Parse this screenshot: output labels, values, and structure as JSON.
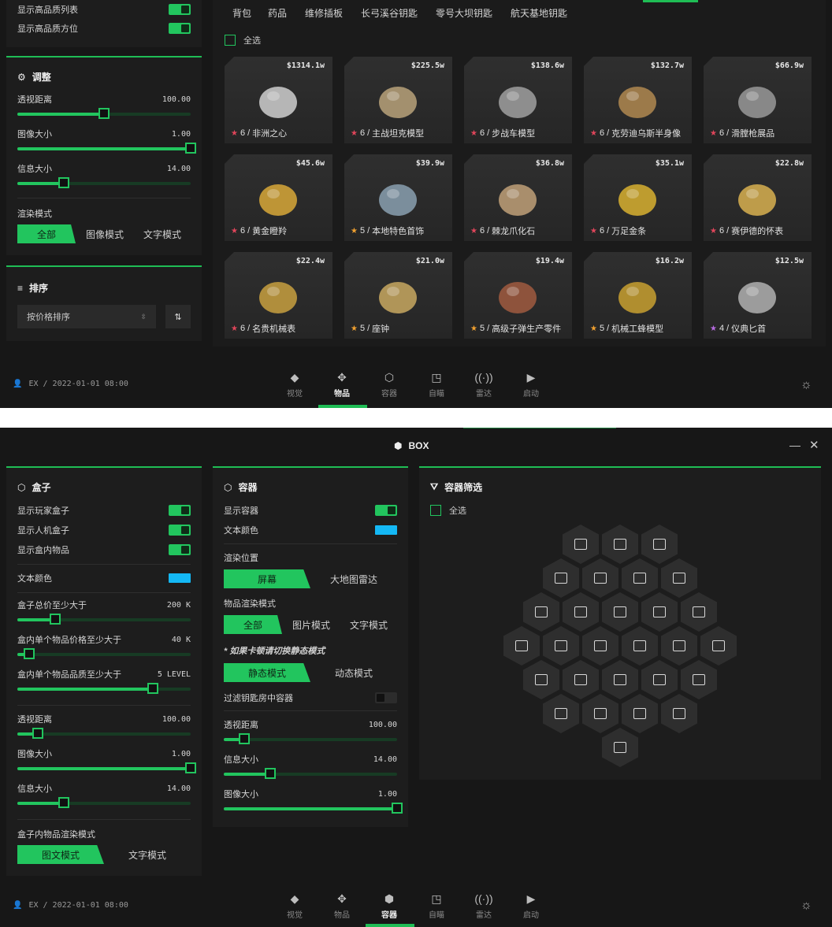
{
  "win1": {
    "top_toggles": [
      {
        "label": "显示高品质列表",
        "on": true
      },
      {
        "label": "显示高品质方位",
        "on": true
      }
    ],
    "adjust": {
      "title": "调整",
      "sliders": [
        {
          "label": "透视距离",
          "value": "100.00",
          "fraction": 0.5
        },
        {
          "label": "图像大小",
          "value": "1.00",
          "fraction": 1.0
        },
        {
          "label": "信息大小",
          "value": "14.00",
          "fraction": 0.27
        }
      ],
      "render_mode_label": "渲染模式",
      "render_modes": [
        "全部",
        "图像模式",
        "文字模式"
      ]
    },
    "sort": {
      "title": "排序",
      "select": "按价格排序"
    },
    "tabs": [
      "背包",
      "药品",
      "维修插板",
      "长弓溪谷钥匙",
      "零号大坝钥匙",
      "航天基地钥匙"
    ],
    "select_all": "全选",
    "items": [
      {
        "price": "$1314.1w",
        "stars": "6",
        "name": "非洲之心",
        "star_color": "#e0455a"
      },
      {
        "price": "$225.5w",
        "stars": "6",
        "name": "主战坦克模型",
        "star_color": "#e0455a"
      },
      {
        "price": "$138.6w",
        "stars": "6",
        "name": "步战车模型",
        "star_color": "#e0455a"
      },
      {
        "price": "$132.7w",
        "stars": "6",
        "name": "克劳迪乌斯半身像",
        "star_color": "#e0455a"
      },
      {
        "price": "$66.9w",
        "stars": "6",
        "name": "滑膛枪展品",
        "star_color": "#e0455a"
      },
      {
        "price": "$45.6w",
        "stars": "6",
        "name": "黄金瞪羚",
        "star_color": "#e0455a"
      },
      {
        "price": "$39.9w",
        "stars": "5",
        "name": "本地特色首饰",
        "star_color": "#f0a030"
      },
      {
        "price": "$36.8w",
        "stars": "6",
        "name": "棘龙爪化石",
        "star_color": "#e0455a"
      },
      {
        "price": "$35.1w",
        "stars": "6",
        "name": "万足金条",
        "star_color": "#e0455a"
      },
      {
        "price": "$22.8w",
        "stars": "6",
        "name": "赛伊德的怀表",
        "star_color": "#e0455a"
      },
      {
        "price": "$22.4w",
        "stars": "6",
        "name": "名贵机械表",
        "star_color": "#e0455a"
      },
      {
        "price": "$21.0w",
        "stars": "5",
        "name": "座钟",
        "star_color": "#f0a030"
      },
      {
        "price": "$19.4w",
        "stars": "5",
        "name": "高级子弹生产零件",
        "star_color": "#f0a030"
      },
      {
        "price": "$16.2w",
        "stars": "5",
        "name": "机械工蜂模型",
        "star_color": "#f0a030"
      },
      {
        "price": "$12.5w",
        "stars": "4",
        "name": "仪典匕首",
        "star_color": "#b66be0"
      }
    ],
    "user": "EX / 2022-01-01 08:00"
  },
  "nav": [
    "视觉",
    "物品",
    "容器",
    "自瞄",
    "雷达",
    "启动"
  ],
  "win2": {
    "title": "BOX",
    "box": {
      "title": "盒子",
      "toggles": [
        {
          "label": "显示玩家盒子",
          "on": true
        },
        {
          "label": "显示人机盒子",
          "on": true
        },
        {
          "label": "显示盒内物品",
          "on": true
        }
      ],
      "text_color_label": "文本颜色",
      "text_color": "#14b8f5",
      "sliders": [
        {
          "label": "盒子总价至少大于",
          "value": "200 K",
          "fraction": 0.22
        },
        {
          "label": "盒内单个物品价格至少大于",
          "value": "40 K",
          "fraction": 0.07
        },
        {
          "label": "盒内单个物品品质至少大于",
          "value": "5 LEVEL",
          "fraction": 0.78
        }
      ],
      "sliders2": [
        {
          "label": "透视距离",
          "value": "100.00",
          "fraction": 0.12
        },
        {
          "label": "图像大小",
          "value": "1.00",
          "fraction": 1.0
        },
        {
          "label": "信息大小",
          "value": "14.00",
          "fraction": 0.27
        }
      ],
      "mode_label": "盒子内物品渲染模式",
      "modes": [
        "图文模式",
        "文字模式"
      ]
    },
    "container": {
      "title": "容器",
      "show_label": "显示容器",
      "text_color_label": "文本颜色",
      "position_label": "渲染位置",
      "positions": [
        "屏幕",
        "大地图雷达"
      ],
      "item_mode_label": "物品渲染模式",
      "item_modes": [
        "全部",
        "图片模式",
        "文字模式"
      ],
      "hint": "* 如果卡顿请切换静态模式",
      "anim_modes": [
        "静态模式",
        "动态模式"
      ],
      "filter_keyroom": "过滤钥匙房中容器",
      "sliders": [
        {
          "label": "透视距离",
          "value": "100.00",
          "fraction": 0.12
        },
        {
          "label": "信息大小",
          "value": "14.00",
          "fraction": 0.27
        },
        {
          "label": "图像大小",
          "value": "1.00",
          "fraction": 1.0
        }
      ]
    },
    "filter": {
      "title": "容器筛选",
      "select_all": "全选"
    },
    "user": "EX / 2022-01-01 08:00"
  }
}
